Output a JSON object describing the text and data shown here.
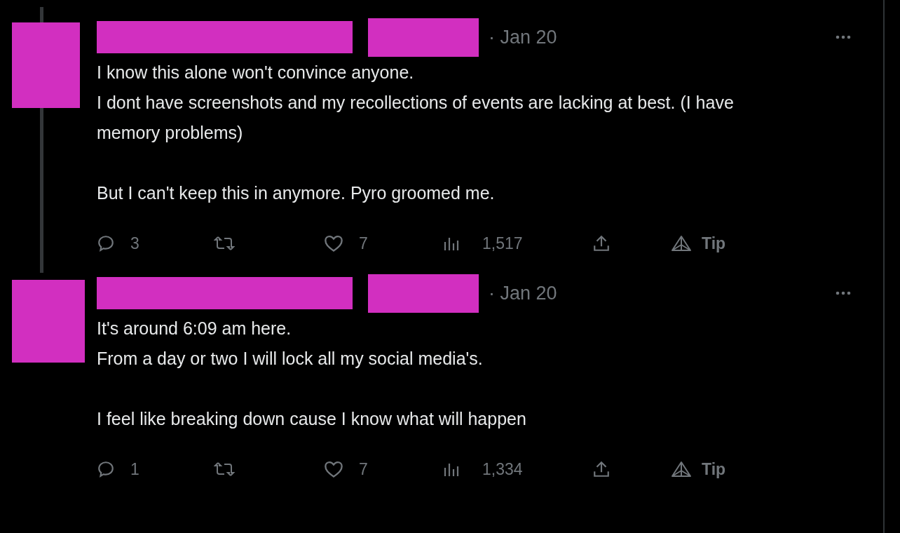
{
  "tweets": [
    {
      "date": "· Jan 20",
      "text": "I know this alone won't convince anyone.\nI dont have screenshots and my recollections of events are lacking at best. (I have memory problems)\n\nBut I can't keep this in anymore. Pyro groomed me.",
      "thread_line": true,
      "replies": "3",
      "likes": "7",
      "views": "1,517",
      "tip": "Tip"
    },
    {
      "date": "· Jan 20",
      "text": "It's around 6:09 am here.\nFrom a day or two I will lock all my social media's.\n\nI feel like breaking down cause I know what will happen",
      "thread_line": false,
      "replies": "1",
      "likes": "7",
      "views": "1,334",
      "tip": "Tip"
    }
  ]
}
